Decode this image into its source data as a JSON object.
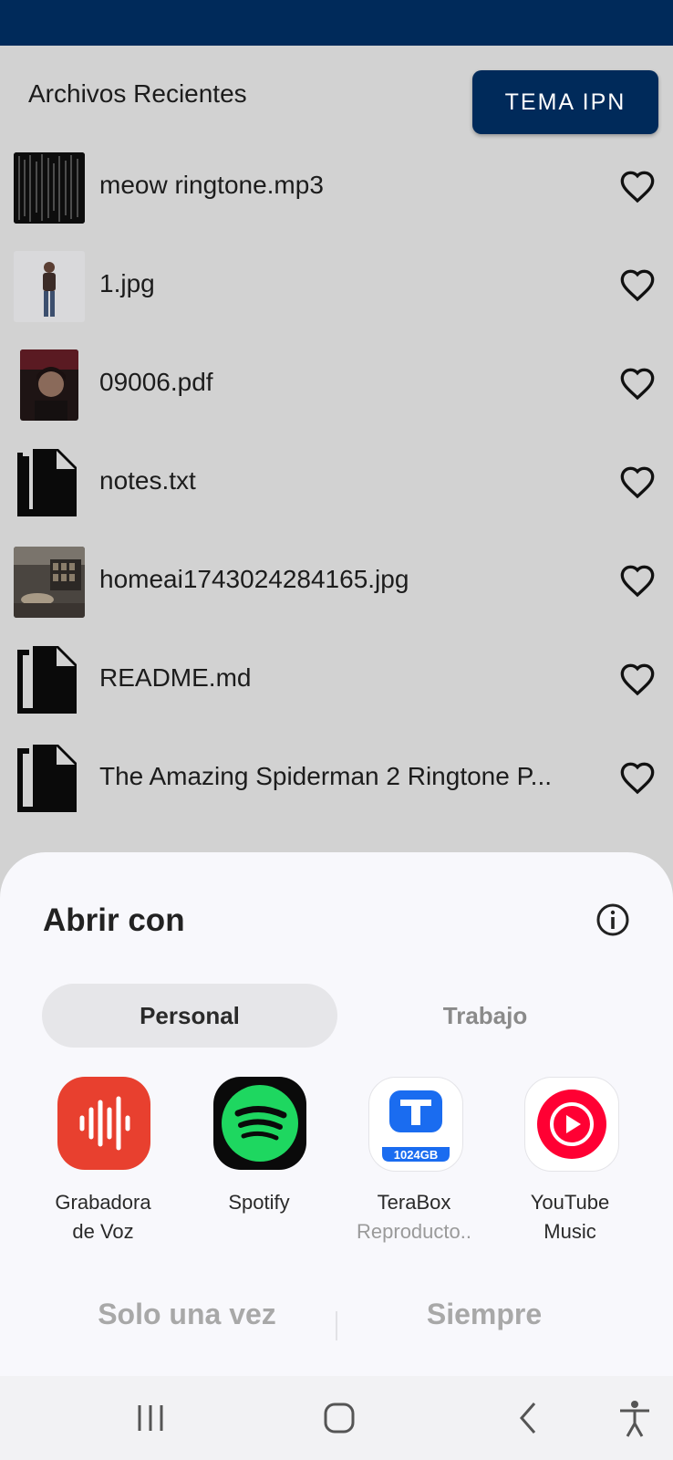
{
  "header": {
    "title": "Archivos Recientes",
    "theme_button": "TEMA IPN"
  },
  "files": [
    {
      "name": "meow ringtone.mp3",
      "thumb": "image-thumbnail"
    },
    {
      "name": "1.jpg",
      "thumb": "image-thumbnail"
    },
    {
      "name": "09006.pdf",
      "thumb": "image-thumbnail"
    },
    {
      "name": "notes.txt",
      "thumb": "file-copy-icon"
    },
    {
      "name": "homeai1743024284165.jpg",
      "thumb": "image-thumbnail"
    },
    {
      "name": "README.md",
      "thumb": "file-copy-icon"
    },
    {
      "name": "The Amazing Spiderman 2 Ringtone  P...",
      "thumb": "file-copy-icon"
    }
  ],
  "sheet": {
    "title": "Abrir con",
    "tabs": [
      "Personal",
      "Trabajo"
    ],
    "apps": [
      {
        "name_line1": "Grabadora",
        "name_line2": "de Voz",
        "sub": ""
      },
      {
        "name_line1": "Spotify",
        "name_line2": "",
        "sub": ""
      },
      {
        "name_line1": "TeraBox",
        "name_line2": "",
        "sub": "Reproducto..",
        "badge": "1024GB"
      },
      {
        "name_line1": "YouTube",
        "name_line2": "Music",
        "sub": ""
      }
    ],
    "once_button": "Solo una vez",
    "always_button": "Siempre"
  },
  "colors": {
    "primary": "#002a5a",
    "background": "#d2d2d2",
    "sheet": "#f8f8fc",
    "recorder": "#e8402f",
    "spotify": "#1ed760",
    "terabox": "#1a6cf0",
    "youtube_music": "#ff0033"
  }
}
